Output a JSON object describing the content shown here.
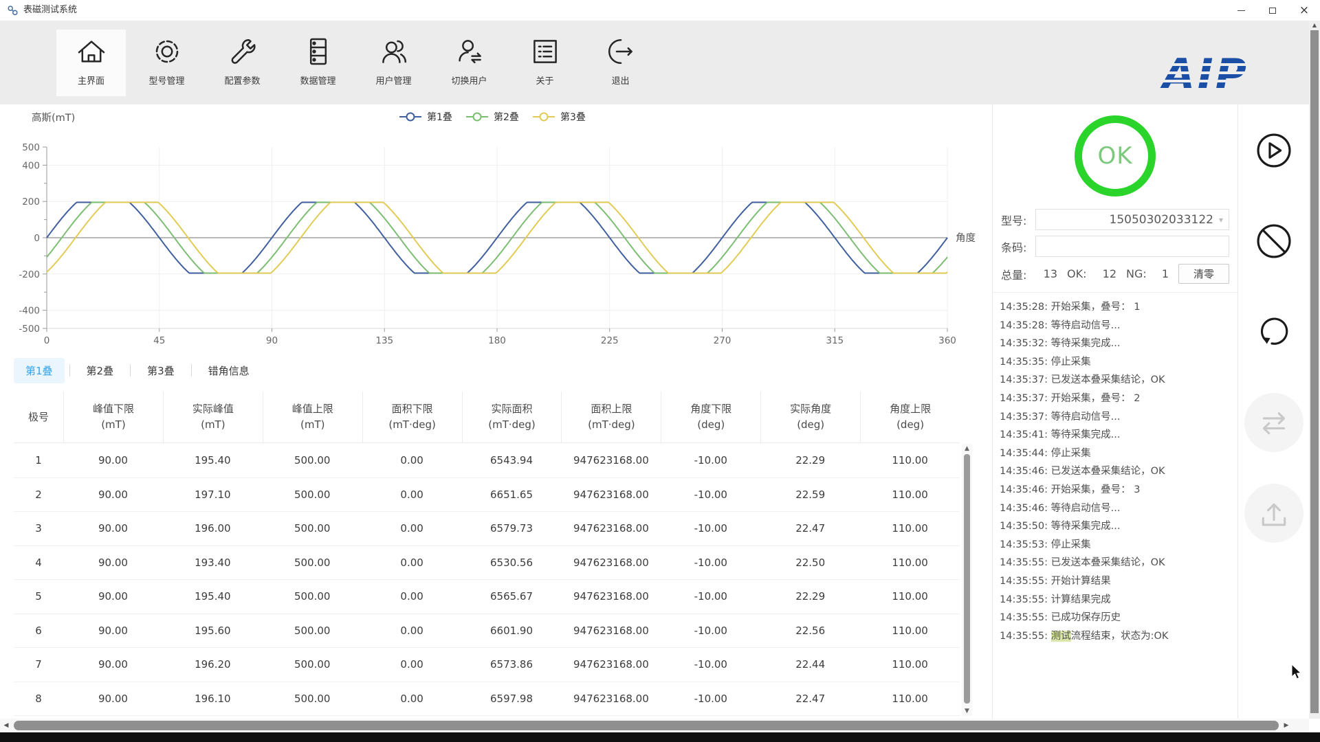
{
  "window": {
    "title": "表磁测试系统",
    "controls": [
      {
        "name": "minimize-button",
        "icon": "minimize-icon"
      },
      {
        "name": "maximize-button",
        "icon": "maximize-icon"
      },
      {
        "name": "close-button",
        "icon": "close-icon"
      }
    ]
  },
  "toolbar": {
    "items": [
      {
        "label": "主界面",
        "icon": "home-icon",
        "active": true
      },
      {
        "label": "型号管理",
        "icon": "gear-icon",
        "active": false
      },
      {
        "label": "配置参数",
        "icon": "wrench-icon",
        "active": false
      },
      {
        "label": "数据管理",
        "icon": "database-icon",
        "active": false
      },
      {
        "label": "用户管理",
        "icon": "users-icon",
        "active": false
      },
      {
        "label": "切换用户",
        "icon": "switch-user-icon",
        "active": false
      },
      {
        "label": "关于",
        "icon": "about-icon",
        "active": false
      },
      {
        "label": "退出",
        "icon": "exit-icon",
        "active": false
      }
    ],
    "logo_text": "AIP",
    "logo_color": "#1b4fa5"
  },
  "chart_data": {
    "type": "line",
    "ylabel": "高斯(mT)",
    "x_axis_right_label": "角度",
    "xlim": [
      0,
      360
    ],
    "ylim": [
      -500,
      500
    ],
    "x_ticks": [
      0,
      45,
      90,
      135,
      180,
      225,
      270,
      315,
      360
    ],
    "y_tick_labels": [
      500,
      400,
      200,
      0,
      -200,
      -400,
      -500
    ],
    "grid": true,
    "legend_position": "top-center",
    "waveform": "clipped-sine",
    "series": [
      {
        "name": "第1叠",
        "color": "#3f5f9f",
        "amplitude_mT": 195,
        "period_deg": 90,
        "phase_deg": 0,
        "overdrive": 1.35
      },
      {
        "name": "第2叠",
        "color": "#7cbe71",
        "amplitude_mT": 195,
        "period_deg": 90,
        "phase_deg": 6,
        "overdrive": 1.35
      },
      {
        "name": "第3叠",
        "color": "#e2cb54",
        "amplitude_mT": 195,
        "period_deg": 90,
        "phase_deg": 11.5,
        "overdrive": 1.35
      }
    ]
  },
  "tabs": {
    "active_index": 0,
    "items": [
      "第1叠",
      "第2叠",
      "第3叠",
      "错角信息"
    ]
  },
  "table": {
    "headers": [
      {
        "line1": "极号",
        "line2": ""
      },
      {
        "line1": "峰值下限",
        "line2": "(mT)"
      },
      {
        "line1": "实际峰值",
        "line2": "(mT)"
      },
      {
        "line1": "峰值上限",
        "line2": "(mT)"
      },
      {
        "line1": "面积下限",
        "line2": "(mT·deg)"
      },
      {
        "line1": "实际面积",
        "line2": "(mT·deg)"
      },
      {
        "line1": "面积上限",
        "line2": "(mT·deg)"
      },
      {
        "line1": "角度下限",
        "line2": "(deg)"
      },
      {
        "line1": "实际角度",
        "line2": "(deg)"
      },
      {
        "line1": "角度上限",
        "line2": "(deg)"
      }
    ],
    "rows": [
      [
        "1",
        "90.00",
        "195.40",
        "500.00",
        "0.00",
        "6543.94",
        "947623168.00",
        "-10.00",
        "22.29",
        "110.00"
      ],
      [
        "2",
        "90.00",
        "197.10",
        "500.00",
        "0.00",
        "6651.65",
        "947623168.00",
        "-10.00",
        "22.59",
        "110.00"
      ],
      [
        "3",
        "90.00",
        "196.00",
        "500.00",
        "0.00",
        "6579.73",
        "947623168.00",
        "-10.00",
        "22.47",
        "110.00"
      ],
      [
        "4",
        "90.00",
        "193.40",
        "500.00",
        "0.00",
        "6530.56",
        "947623168.00",
        "-10.00",
        "22.50",
        "110.00"
      ],
      [
        "5",
        "90.00",
        "195.40",
        "500.00",
        "0.00",
        "6565.67",
        "947623168.00",
        "-10.00",
        "22.29",
        "110.00"
      ],
      [
        "6",
        "90.00",
        "195.60",
        "500.00",
        "0.00",
        "6601.90",
        "947623168.00",
        "-10.00",
        "22.56",
        "110.00"
      ],
      [
        "7",
        "90.00",
        "196.20",
        "500.00",
        "0.00",
        "6573.86",
        "947623168.00",
        "-10.00",
        "22.44",
        "110.00"
      ],
      [
        "8",
        "90.00",
        "196.10",
        "500.00",
        "0.00",
        "6597.98",
        "947623168.00",
        "-10.00",
        "22.47",
        "110.00"
      ]
    ]
  },
  "status_panel": {
    "result_text": "OK",
    "result_color": "#2bd42b",
    "model_label": "型号:",
    "model_value": "15050302033122",
    "barcode_label": "条码:",
    "barcode_value": "",
    "total_label": "总量:",
    "total_value": "13",
    "ok_label": "OK:",
    "ok_value": "12",
    "ng_label": "NG:",
    "ng_value": "1",
    "clear_button_label": "清零"
  },
  "log": {
    "entries": [
      "14:35:28: 开始采集，叠号： 1",
      "14:35:28: 等待启动信号...",
      "14:35:32: 等待采集完成...",
      "14:35:35: 停止采集",
      "14:35:37: 已发送本叠采集结论，OK",
      "14:35:37: 开始采集，叠号： 2",
      "14:35:37: 等待启动信号...",
      "14:35:41: 等待采集完成...",
      "14:35:44: 停止采集",
      "14:35:46: 已发送本叠采集结论，OK",
      "14:35:46: 开始采集，叠号： 3",
      "14:35:46: 等待启动信号...",
      "14:35:50: 等待采集完成...",
      "14:35:53: 停止采集",
      "14:35:55: 已发送本叠采集结论，OK",
      "14:35:55: 开始计算结果",
      "14:35:55: 计算结果完成",
      "14:35:55: 已成功保存历史",
      {
        "text": "14:35:55: 测试流程结束，状态为:OK",
        "mark": "测试"
      }
    ]
  },
  "side_buttons": [
    {
      "name": "start-button",
      "icon": "play-circle-icon",
      "enabled": true
    },
    {
      "name": "stop-button",
      "icon": "no-entry-icon",
      "enabled": true
    },
    {
      "name": "retry-button",
      "icon": "rotate-icon",
      "enabled": true
    },
    {
      "name": "transfer-button",
      "icon": "swap-arrows-icon",
      "enabled": false
    },
    {
      "name": "upload-button",
      "icon": "upload-icon",
      "enabled": false
    }
  ]
}
